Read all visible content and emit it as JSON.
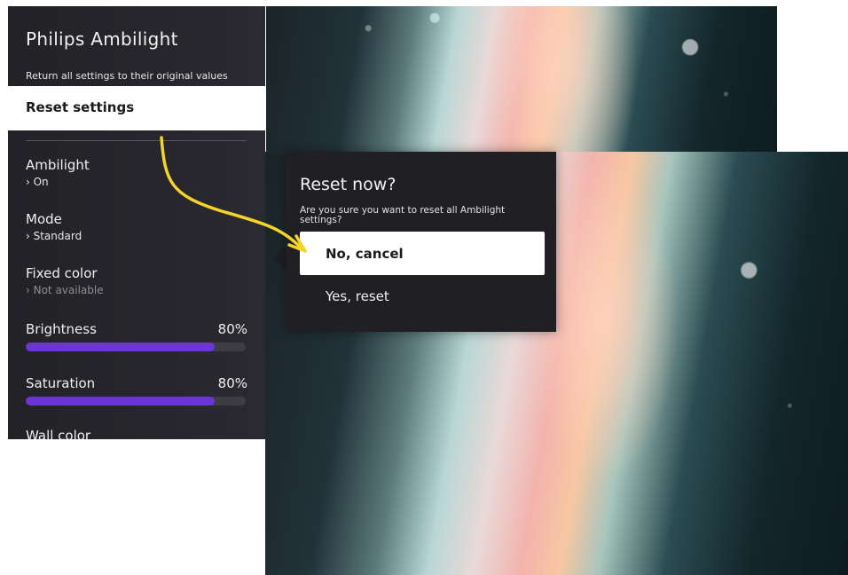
{
  "panel": {
    "title": "Philips Ambilight",
    "subtitle": "Return all settings to their original values",
    "reset_label": "Reset settings",
    "items": [
      {
        "label": "Ambilight",
        "value": "› On"
      },
      {
        "label": "Mode",
        "value": "› Standard"
      },
      {
        "label": "Fixed color",
        "value": "› Not available"
      }
    ],
    "sliders": [
      {
        "label": "Brightness",
        "value_text": "80%",
        "level": 0.86
      },
      {
        "label": "Saturation",
        "value_text": "80%",
        "level": 0.86
      }
    ],
    "wall_color_label": "Wall color"
  },
  "dialog": {
    "title": "Reset now?",
    "message": "Are you sure you want to reset all Ambilight settings?",
    "cancel_label": "No, cancel",
    "confirm_label": "Yes, reset"
  },
  "colors": {
    "accent": "#6c35d8",
    "arrow": "#f2d42c",
    "panel_bg": "#26262c"
  }
}
